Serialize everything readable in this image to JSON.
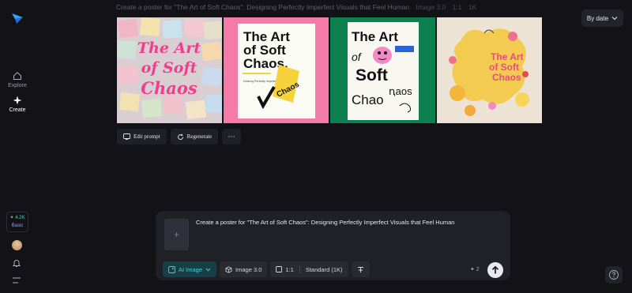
{
  "sidebar": {
    "logo_icon": "paper-plane-logo",
    "explore_label": "Explore",
    "create_label": "Create",
    "credits_amount": "✦ 4.2K",
    "plan_label": "Basic"
  },
  "header": {
    "prompt_title": "Create a poster for \"The Art of Soft Chaos\": Designing Perfectly Imperfect Visuals that Feel Human",
    "model": "Image 3.0",
    "ratio": "1:1",
    "resolution": "1K",
    "sort_label": "By date"
  },
  "gallery": {
    "tile1": {
      "line1": "The Art",
      "line2": "of Soft",
      "line3": "Chaos"
    },
    "tile2": {
      "line1": "The Art",
      "line2": "of Soft",
      "line3": "Chaos.",
      "sub": "Desking Perfectly Imperfect Visuals",
      "badge": "Chaos"
    },
    "tile3": {
      "line1": "The Art",
      "line2": "of",
      "line3": "Soft",
      "line4": "Chao",
      "line5": "ꞑaos"
    },
    "tile4": {
      "line1": "The Art",
      "line2": "of Soft",
      "line3": "Chaos"
    }
  },
  "actions": {
    "edit_label": "Edit prompt",
    "regenerate_label": "Regenerate",
    "more_label": "···"
  },
  "composer": {
    "prompt_text": "Create a poster for \"The Art of Soft Chaos\": Designing Perfectly Imperfect Visuals that Feel Human",
    "add_symbol": "+",
    "ai_image_label": "AI Image",
    "model_label": "Image 3.0",
    "ratio_label": "1:1",
    "quality_label": "Standard (1K)",
    "count_label": "✦ 2"
  },
  "colors": {
    "accent": "#41d3d3",
    "background": "#121217"
  }
}
